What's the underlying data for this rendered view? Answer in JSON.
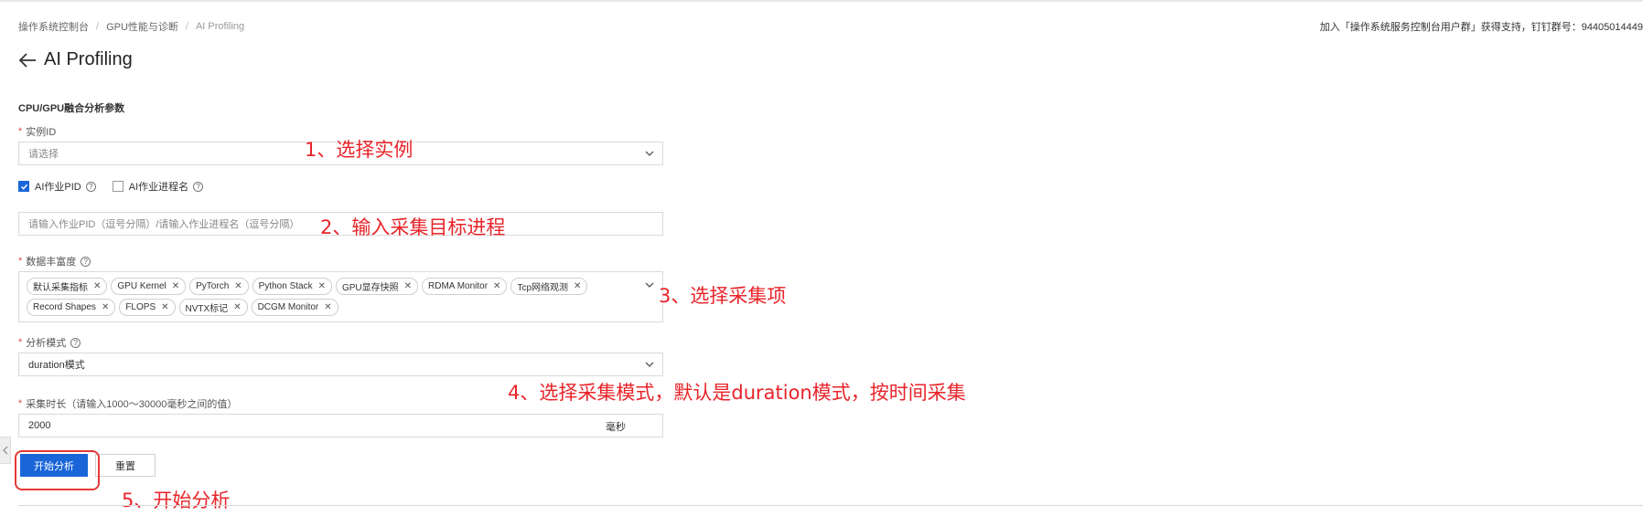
{
  "breadcrumb": {
    "items": [
      "操作系统控制台",
      "GPU性能与诊断",
      "AI Profiling"
    ]
  },
  "support": {
    "text": "加入「操作系统服务控制台用户群」获得支持，钉钉群号：94405014449"
  },
  "page": {
    "title": "AI Profiling"
  },
  "section": {
    "title": "CPU/GPU融合分析参数"
  },
  "form": {
    "required_mark": "*",
    "instance": {
      "label": "实例ID",
      "placeholder": "请选择"
    },
    "options": {
      "pid_label": "AI作业PID",
      "pid_checked": true,
      "name_label": "AI作业进程名",
      "name_checked": false
    },
    "target": {
      "placeholder": "请输入作业PID（逗号分隔）/请输入作业进程名（逗号分隔）"
    },
    "richness": {
      "label": "数据丰富度",
      "tags": [
        "默认采集指标",
        "GPU Kernel",
        "PyTorch",
        "Python Stack",
        "GPU显存快照",
        "RDMA Monitor",
        "Tcp网络观测",
        "Record Shapes",
        "FLOPS",
        "NVTX标记",
        "DCGM Monitor"
      ]
    },
    "mode": {
      "label": "分析模式",
      "value": "duration模式"
    },
    "duration": {
      "label": "采集时长（请输入1000～30000毫秒之间的值）",
      "value": "2000",
      "unit": "毫秒"
    }
  },
  "buttons": {
    "start": "开始分析",
    "reset": "重置"
  },
  "annotations": {
    "a1": "1、选择实例",
    "a2": "2、输入采集目标进程",
    "a3": "3、选择采集项",
    "a4": "4、选择采集模式，默认是duration模式，按时间采集",
    "a5": "5、开始分析"
  },
  "colors": {
    "primary": "#1a66d9",
    "annotation": "#e8242a",
    "required": "#e5484d"
  }
}
